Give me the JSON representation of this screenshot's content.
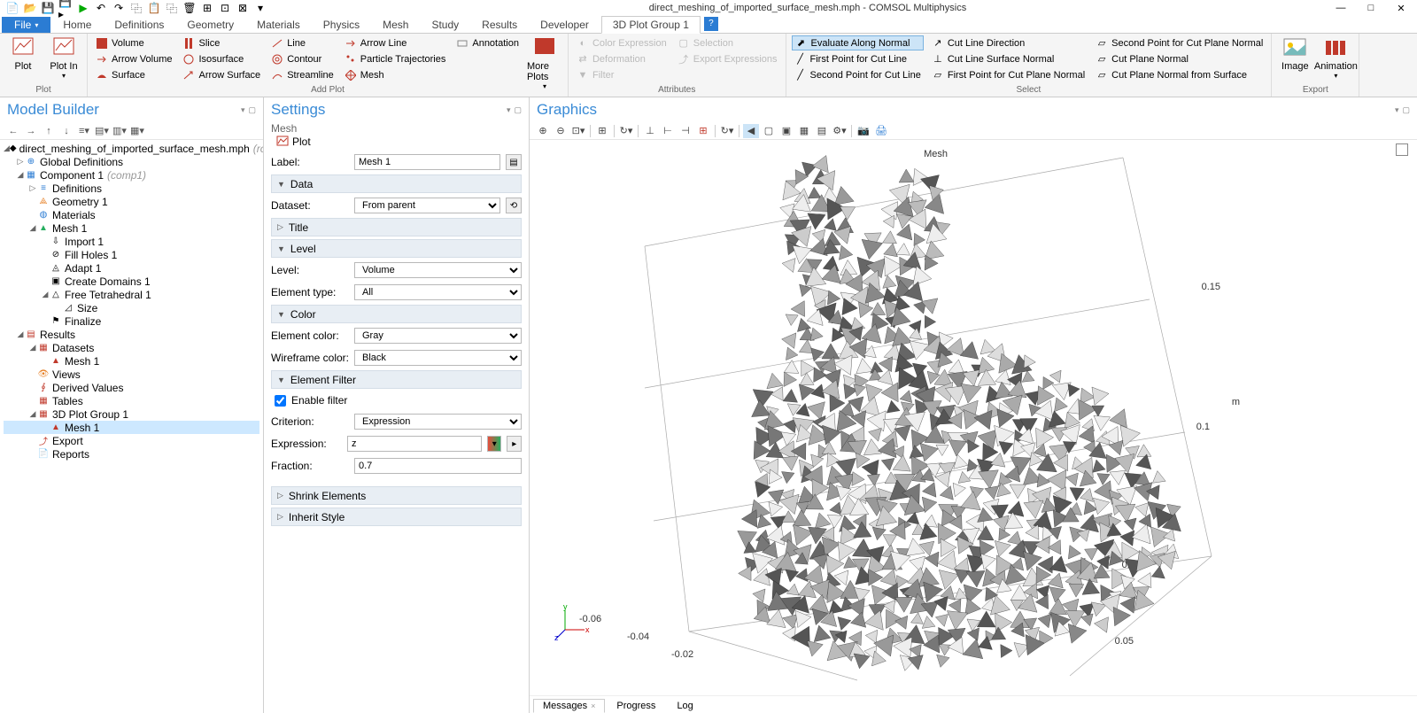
{
  "title": "direct_meshing_of_imported_surface_mesh.mph - COMSOL Multiphysics",
  "ribbon_tabs": {
    "file": "File",
    "home": "Home",
    "definitions": "Definitions",
    "geometry": "Geometry",
    "materials": "Materials",
    "physics": "Physics",
    "mesh": "Mesh",
    "study": "Study",
    "results": "Results",
    "developer": "Developer",
    "plot3d": "3D Plot Group 1"
  },
  "ribbon": {
    "plot_group": "Plot",
    "plot": "Plot",
    "plot_in": "Plot In",
    "add_plot_group": "Add Plot",
    "volume": "Volume",
    "arrow_volume": "Arrow Volume",
    "surface": "Surface",
    "slice": "Slice",
    "isosurface": "Isosurface",
    "arrow_surface": "Arrow Surface",
    "line": "Line",
    "contour": "Contour",
    "streamline": "Streamline",
    "arrow_line": "Arrow Line",
    "particle": "Particle Trajectories",
    "mesh": "Mesh",
    "annotation": "Annotation",
    "more_plots": "More Plots",
    "attributes_group": "Attributes",
    "color_expression": "Color Expression",
    "deformation": "Deformation",
    "filter": "Filter",
    "selection": "Selection",
    "export_expr": "Export Expressions",
    "select_group": "Select",
    "evaluate_normal": "Evaluate Along Normal",
    "first_point_cut": "First Point for Cut Line",
    "second_point_cut": "Second Point for Cut Line",
    "cut_line_dir": "Cut Line Direction",
    "cut_line_surf_normal": "Cut Line Surface Normal",
    "first_point_plane_normal": "First Point for Cut Plane Normal",
    "second_point_plane_normal": "Second Point for Cut Plane Normal",
    "cut_plane_normal": "Cut Plane Normal",
    "cut_plane_normal_surface": "Cut Plane Normal from Surface",
    "export_group": "Export",
    "image": "Image",
    "animation": "Animation"
  },
  "model_builder": {
    "title": "Model Builder",
    "root": "direct_meshing_of_imported_surface_mesh.mph",
    "root_suffix": "(root)",
    "global_def": "Global Definitions",
    "component": "Component 1",
    "component_suffix": "(comp1)",
    "definitions": "Definitions",
    "geometry": "Geometry 1",
    "materials": "Materials",
    "mesh1": "Mesh 1",
    "import1": "Import 1",
    "fill_holes": "Fill Holes 1",
    "adapt1": "Adapt 1",
    "create_domains": "Create Domains 1",
    "free_tet": "Free Tetrahedral 1",
    "size": "Size",
    "finalize": "Finalize",
    "results": "Results",
    "datasets": "Datasets",
    "mesh_dataset": "Mesh 1",
    "views": "Views",
    "derived_values": "Derived Values",
    "tables": "Tables",
    "plot_group": "3D Plot Group 1",
    "mesh_plot": "Mesh 1",
    "export": "Export",
    "reports": "Reports"
  },
  "settings": {
    "title": "Settings",
    "subtitle": "Mesh",
    "plot_btn": "Plot",
    "label_label": "Label:",
    "label_value": "Mesh 1",
    "data_section": "Data",
    "dataset_label": "Dataset:",
    "dataset_value": "From parent",
    "title_section": "Title",
    "level_section": "Level",
    "level_label": "Level:",
    "level_value": "Volume",
    "element_type_label": "Element type:",
    "element_type_value": "All",
    "color_section": "Color",
    "element_color_label": "Element color:",
    "element_color_value": "Gray",
    "wireframe_color_label": "Wireframe color:",
    "wireframe_color_value": "Black",
    "filter_section": "Element Filter",
    "enable_filter": "Enable filter",
    "criterion_label": "Criterion:",
    "criterion_value": "Expression",
    "expression_label": "Expression:",
    "expression_value": "z",
    "fraction_label": "Fraction:",
    "fraction_value": "0.7",
    "shrink_section": "Shrink Elements",
    "inherit_section": "Inherit Style"
  },
  "graphics": {
    "title": "Graphics",
    "mesh_label": "Mesh",
    "m_label": "m",
    "ticks": {
      "z1": "0.05",
      "z2": "0.1",
      "z3": "0.15",
      "x1": "-0.06",
      "x2": "-0.04",
      "x3": "-0.02",
      "x4": "0.05"
    },
    "axes": {
      "y": "y",
      "x": "x",
      "z": "z"
    }
  },
  "bottom_tabs": {
    "messages": "Messages",
    "progress": "Progress",
    "log": "Log"
  }
}
